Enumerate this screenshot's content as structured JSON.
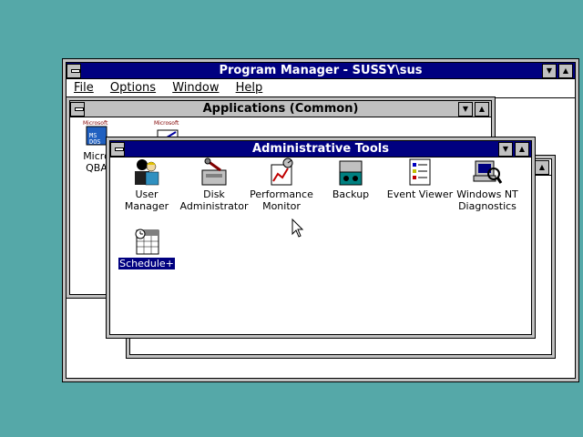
{
  "program_manager": {
    "title": "Program Manager - SUSSY\\sus",
    "menu": [
      "File",
      "Options",
      "Window",
      "Help"
    ]
  },
  "applications_window": {
    "title": "Applications (Common)",
    "partial_icons": [
      {
        "label_line1": "Micro",
        "label_line2": "QBA",
        "icon": "msdos-qbasic-icon"
      },
      {
        "label_line1": "",
        "label_line2": "",
        "icon": "write-icon"
      }
    ]
  },
  "admin_tools": {
    "title": "Administrative Tools",
    "icons": [
      {
        "label": [
          "User Manager"
        ],
        "icon": "user-manager-icon"
      },
      {
        "label": [
          "Disk",
          "Administrator"
        ],
        "icon": "disk-administrator-icon"
      },
      {
        "label": [
          "Performance",
          "Monitor"
        ],
        "icon": "performance-monitor-icon"
      },
      {
        "label": [
          "Backup"
        ],
        "icon": "backup-icon"
      },
      {
        "label": [
          "Event Viewer"
        ],
        "icon": "event-viewer-icon"
      },
      {
        "label": [
          "Windows NT",
          "Diagnostics"
        ],
        "icon": "nt-diagnostics-icon"
      },
      {
        "label": [
          "Schedule+"
        ],
        "icon": "schedule-plus-icon",
        "selected": true
      }
    ]
  },
  "colors": {
    "desktop": "#55a8a8",
    "active_title": "#000080",
    "selection": "#000080"
  }
}
